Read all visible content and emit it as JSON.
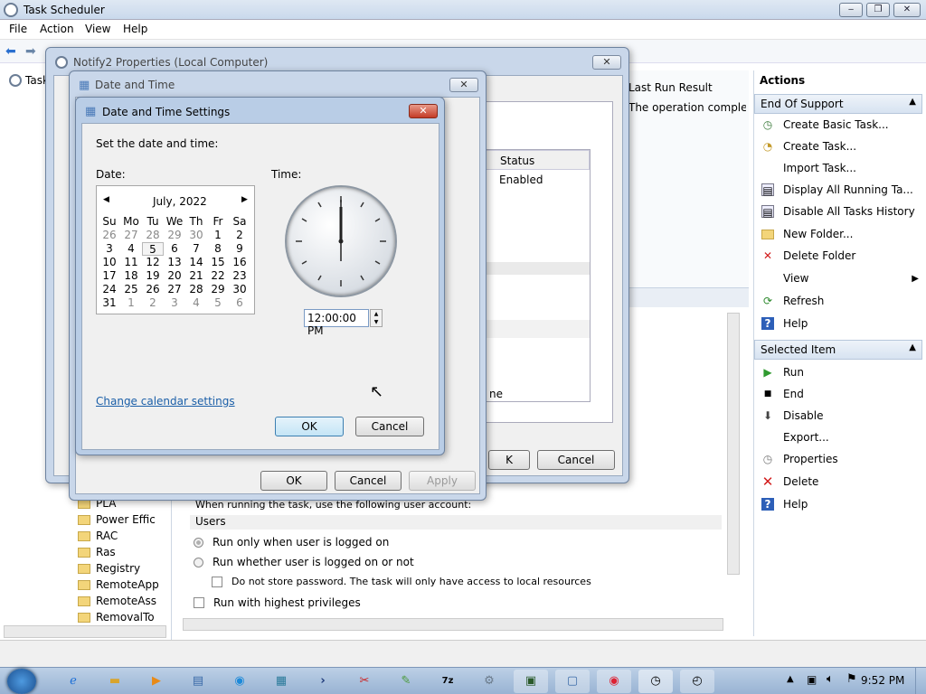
{
  "window": {
    "title": "Task Scheduler"
  },
  "menu": [
    "File",
    "Action",
    "View",
    "Help"
  ],
  "tree": {
    "root": "Task",
    "folders": [
      "PLA",
      "Power Effic",
      "RAC",
      "Ras",
      "Registry",
      "RemoteApp",
      "RemoteAss",
      "RemovalTo"
    ]
  },
  "center": {
    "last_run_header": "Last Run Result",
    "last_run_value": "The operation complete",
    "status_header": "Status",
    "status_value": "Enabled",
    "fragment_text": "ne",
    "user_account_text": "When running the task, use the following user account:",
    "users_value": "Users",
    "radio_logged_on": "Run only when user is logged on",
    "radio_logged_on_or_not": "Run whether user is logged on or not",
    "check_no_store": "Do not store password.  The task will only have access to local resources",
    "check_highest": "Run with highest privileges"
  },
  "actions": {
    "title": "Actions",
    "sections": [
      {
        "title": "End Of Support",
        "items": [
          {
            "label": "Create Basic Task...",
            "icon": "create-basic-task-icon"
          },
          {
            "label": "Create Task...",
            "icon": "create-task-icon"
          },
          {
            "label": "Import Task...",
            "icon": ""
          },
          {
            "label": "Display All Running Ta...",
            "icon": "running-tasks-icon"
          },
          {
            "label": "Disable All Tasks History",
            "icon": "history-icon"
          },
          {
            "label": "New Folder...",
            "icon": "folder-icon"
          },
          {
            "label": "Delete Folder",
            "icon": "delete-x-icon"
          },
          {
            "label": "View",
            "icon": ""
          },
          {
            "label": "Refresh",
            "icon": "refresh-icon"
          },
          {
            "label": "Help",
            "icon": "help-icon"
          }
        ]
      },
      {
        "title": "Selected Item",
        "items": [
          {
            "label": "Run",
            "icon": "run-icon"
          },
          {
            "label": "End",
            "icon": "end-icon"
          },
          {
            "label": "Disable",
            "icon": "disable-icon"
          },
          {
            "label": "Export...",
            "icon": ""
          },
          {
            "label": "Properties",
            "icon": "properties-icon"
          },
          {
            "label": "Delete",
            "icon": "delete-icon"
          },
          {
            "label": "Help",
            "icon": "help-icon"
          }
        ]
      }
    ]
  },
  "dialogs": {
    "notify": {
      "title": "Notify2 Properties (Local Computer)",
      "ok": "OK",
      "cancel": "Cancel",
      "ok_partial": "K"
    },
    "date_time": {
      "title": "Date and Time",
      "ok": "OK",
      "cancel": "Cancel",
      "apply": "Apply"
    },
    "settings": {
      "title": "Date and Time Settings",
      "prompt": "Set the date and time:",
      "date_label": "Date:",
      "time_label": "Time:",
      "month": "July, 2022",
      "weekdays": [
        "Su",
        "Mo",
        "Tu",
        "We",
        "Th",
        "Fr",
        "Sa"
      ],
      "weeks": [
        [
          "26",
          "27",
          "28",
          "29",
          "30",
          "1",
          "2"
        ],
        [
          "3",
          "4",
          "5",
          "6",
          "7",
          "8",
          "9"
        ],
        [
          "10",
          "11",
          "12",
          "13",
          "14",
          "15",
          "16"
        ],
        [
          "17",
          "18",
          "19",
          "20",
          "21",
          "22",
          "23"
        ],
        [
          "24",
          "25",
          "26",
          "27",
          "28",
          "29",
          "30"
        ],
        [
          "31",
          "1",
          "2",
          "3",
          "4",
          "5",
          "6"
        ]
      ],
      "time_value": "12:00:00 PM",
      "change_link": "Change calendar settings",
      "ok": "OK",
      "cancel": "Cancel"
    }
  },
  "taskbar": {
    "clock": "9:52 PM"
  }
}
